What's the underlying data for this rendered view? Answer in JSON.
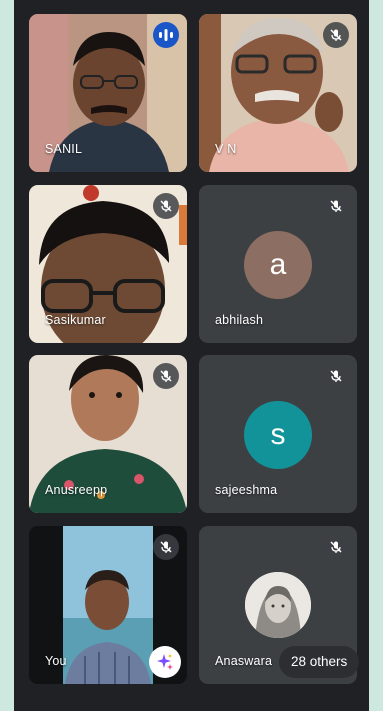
{
  "colors": {
    "tile_bg": "#3c4043",
    "speaking_indicator": "#1a56c8",
    "avatar_abhilash": "#8d6e63",
    "avatar_sajeeshma": "#12939a"
  },
  "participants": [
    {
      "name": "SANIL",
      "status": "speaking",
      "icon": "audio-level-icon"
    },
    {
      "name": "V N",
      "status": "muted",
      "icon": "mic-off-icon"
    },
    {
      "name": "Sasikumar",
      "status": "muted",
      "icon": "mic-off-icon"
    },
    {
      "name": "abhilash",
      "status": "muted",
      "icon": "mic-off-icon",
      "avatar_letter": "a"
    },
    {
      "name": "Anusreepp",
      "status": "muted",
      "icon": "mic-off-icon"
    },
    {
      "name": "sajeeshma",
      "status": "muted",
      "icon": "mic-off-icon",
      "avatar_letter": "s"
    },
    {
      "name": "You",
      "status": "muted",
      "icon": "mic-off-icon",
      "effects_icon": "sparkle-icon"
    },
    {
      "name": "Anaswara",
      "status": "muted",
      "icon": "mic-off-icon"
    }
  ],
  "others_chip": {
    "label": "28 others"
  }
}
